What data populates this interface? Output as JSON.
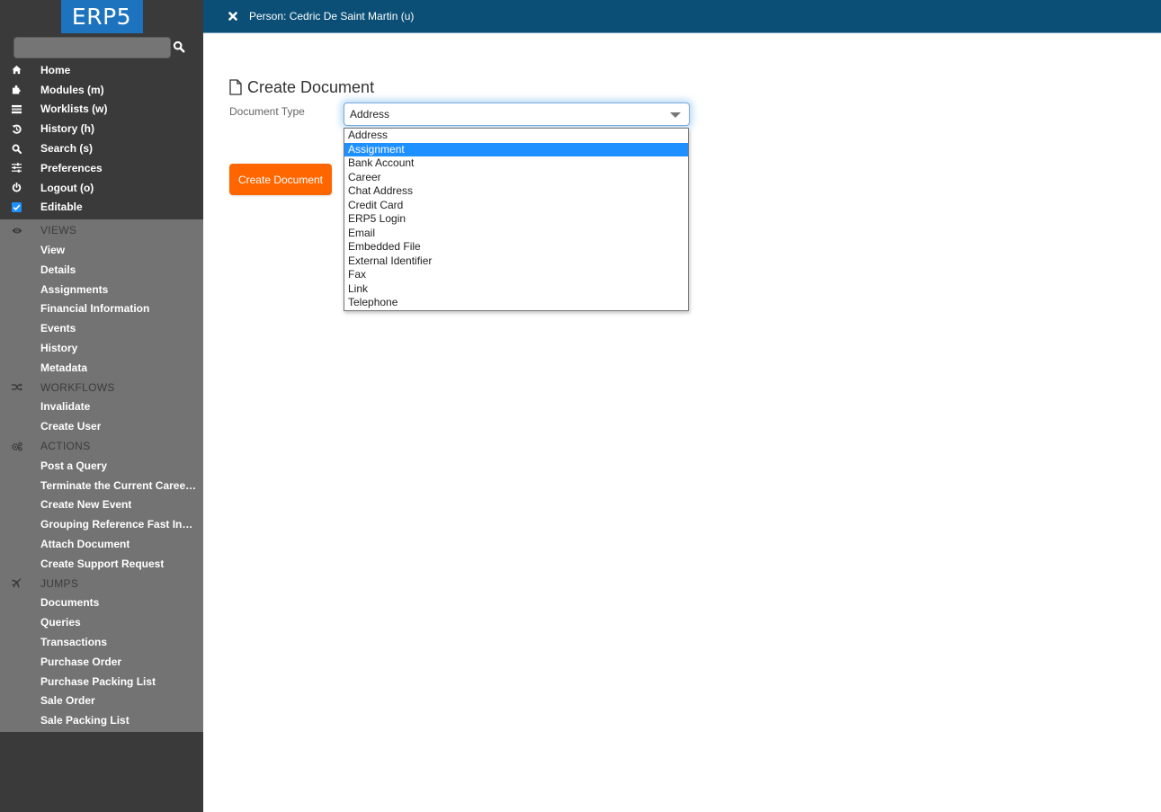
{
  "app": {
    "logo_text": "ERP5",
    "brand_color": "#1e73be",
    "header_color": "#0b4f77",
    "accent_color": "#ff6600"
  },
  "sidebar": {
    "search": {
      "value": "",
      "placeholder": "",
      "icon": "search-icon"
    },
    "nav": [
      {
        "label": "Home",
        "icon": "home-icon"
      },
      {
        "label": "Modules (m)",
        "icon": "puzzle-icon"
      },
      {
        "label": "Worklists (w)",
        "icon": "tasks-icon"
      },
      {
        "label": "History (h)",
        "icon": "history-icon"
      },
      {
        "label": "Search (s)",
        "icon": "search-icon"
      },
      {
        "label": "Preferences",
        "icon": "sliders-icon"
      },
      {
        "label": "Logout (o)",
        "icon": "power-icon"
      },
      {
        "label": "Editable",
        "icon": "checkbox-icon",
        "checked": true
      }
    ],
    "sections": [
      {
        "title": "VIEWS",
        "icon": "eye-icon",
        "items": [
          "View",
          "Details",
          "Assignments",
          "Financial Information",
          "Events",
          "History",
          "Metadata"
        ]
      },
      {
        "title": "WORKFLOWS",
        "icon": "random-icon",
        "items": [
          "Invalidate",
          "Create User"
        ]
      },
      {
        "title": "ACTIONS",
        "icon": "cogs-icon",
        "items": [
          "Post a Query",
          "Terminate the Current Career...",
          "Create New Event",
          "Grouping Reference Fast Input",
          "Attach Document",
          "Create Support Request"
        ]
      },
      {
        "title": "JUMPS",
        "icon": "plane-icon",
        "items": [
          "Documents",
          "Queries",
          "Transactions",
          "Purchase Order",
          "Purchase Packing List",
          "Sale Order",
          "Sale Packing List"
        ]
      }
    ]
  },
  "header": {
    "title": "Person: Cedric De Saint Martin (u)",
    "close_icon": "close-icon"
  },
  "main": {
    "page_title": "Create Document",
    "page_icon": "file-icon",
    "field_label": "Document Type",
    "selected_value": "Address",
    "highlighted_option": "Assignment",
    "options": [
      "Address",
      "Assignment",
      "Bank Account",
      "Career",
      "Chat Address",
      "Credit Card",
      "ERP5 Login",
      "Email",
      "Embedded File",
      "External Identifier",
      "Fax",
      "Link",
      "Telephone"
    ],
    "submit_label": "Create Document"
  }
}
